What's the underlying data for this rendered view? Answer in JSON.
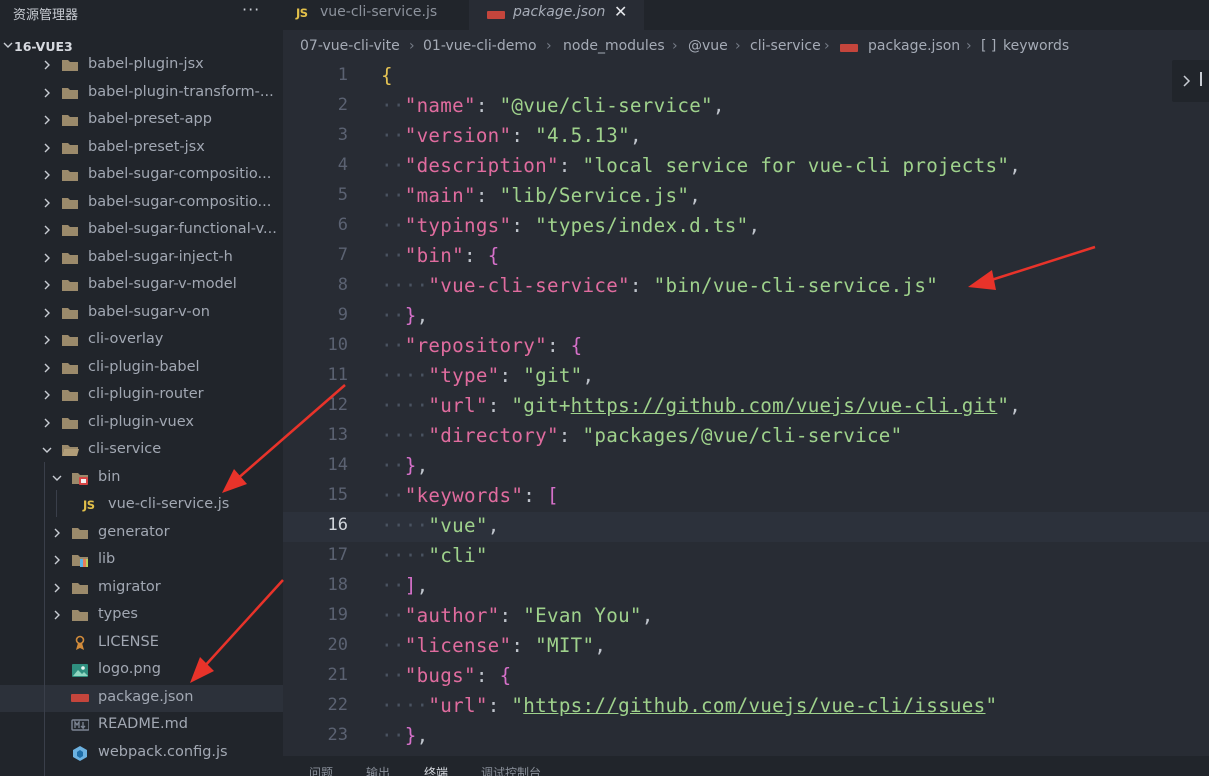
{
  "sidebar": {
    "title": "资源管理器",
    "more": "···",
    "project": "16-VUE3",
    "tree": [
      {
        "label": "babel-plugin-jsx",
        "type": "folder",
        "depth": 0
      },
      {
        "label": "babel-plugin-transform-...",
        "type": "folder",
        "depth": 0
      },
      {
        "label": "babel-preset-app",
        "type": "folder",
        "depth": 0
      },
      {
        "label": "babel-preset-jsx",
        "type": "folder",
        "depth": 0
      },
      {
        "label": "babel-sugar-compositio...",
        "type": "folder",
        "depth": 0
      },
      {
        "label": "babel-sugar-compositio...",
        "type": "folder",
        "depth": 0
      },
      {
        "label": "babel-sugar-functional-v...",
        "type": "folder",
        "depth": 0
      },
      {
        "label": "babel-sugar-inject-h",
        "type": "folder",
        "depth": 0
      },
      {
        "label": "babel-sugar-v-model",
        "type": "folder",
        "depth": 0
      },
      {
        "label": "babel-sugar-v-on",
        "type": "folder",
        "depth": 0
      },
      {
        "label": "cli-overlay",
        "type": "folder",
        "depth": 0
      },
      {
        "label": "cli-plugin-babel",
        "type": "folder",
        "depth": 0
      },
      {
        "label": "cli-plugin-router",
        "type": "folder",
        "depth": 0
      },
      {
        "label": "cli-plugin-vuex",
        "type": "folder",
        "depth": 0
      },
      {
        "label": "cli-service",
        "type": "folder-open",
        "depth": 0
      },
      {
        "label": "bin",
        "type": "folder-bin-open",
        "depth": 1
      },
      {
        "label": "vue-cli-service.js",
        "type": "js",
        "depth": 2
      },
      {
        "label": "generator",
        "type": "folder",
        "depth": 1
      },
      {
        "label": "lib",
        "type": "folder-lib",
        "depth": 1
      },
      {
        "label": "migrator",
        "type": "folder",
        "depth": 1
      },
      {
        "label": "types",
        "type": "folder",
        "depth": 1
      },
      {
        "label": "LICENSE",
        "type": "license",
        "depth": 1
      },
      {
        "label": "logo.png",
        "type": "image",
        "depth": 1
      },
      {
        "label": "package.json",
        "type": "npm",
        "depth": 1,
        "selected": true
      },
      {
        "label": "README.md",
        "type": "markdown",
        "depth": 1
      },
      {
        "label": "webpack.config.js",
        "type": "webpack",
        "depth": 1
      }
    ]
  },
  "tabs": [
    {
      "badge": "JS",
      "label": "vue-cli-service.js"
    },
    {
      "label": "package.json",
      "close": "✕"
    }
  ],
  "breadcrumb": [
    "07-vue-cli-vite",
    "01-vue-cli-demo",
    "node_modules",
    "@vue",
    "cli-service",
    "package.json",
    "[ ]",
    "keywords"
  ],
  "code": {
    "current_line": 16,
    "lines": [
      [
        [
          "b1",
          "{"
        ]
      ],
      [
        [
          "ws",
          "··"
        ],
        [
          "k",
          "\"name\""
        ],
        [
          "p",
          ": "
        ],
        [
          "s",
          "\"@vue/cli-service\""
        ],
        [
          "p",
          ","
        ]
      ],
      [
        [
          "ws",
          "··"
        ],
        [
          "k",
          "\"version\""
        ],
        [
          "p",
          ": "
        ],
        [
          "s",
          "\"4.5.13\""
        ],
        [
          "p",
          ","
        ]
      ],
      [
        [
          "ws",
          "··"
        ],
        [
          "k",
          "\"description\""
        ],
        [
          "p",
          ": "
        ],
        [
          "s",
          "\"local service for vue-cli projects\""
        ],
        [
          "p",
          ","
        ]
      ],
      [
        [
          "ws",
          "··"
        ],
        [
          "k",
          "\"main\""
        ],
        [
          "p",
          ": "
        ],
        [
          "s",
          "\"lib/Service.js\""
        ],
        [
          "p",
          ","
        ]
      ],
      [
        [
          "ws",
          "··"
        ],
        [
          "k",
          "\"typings\""
        ],
        [
          "p",
          ": "
        ],
        [
          "s",
          "\"types/index.d.ts\""
        ],
        [
          "p",
          ","
        ]
      ],
      [
        [
          "ws",
          "··"
        ],
        [
          "k",
          "\"bin\""
        ],
        [
          "p",
          ": "
        ],
        [
          "b2",
          "{"
        ]
      ],
      [
        [
          "ws",
          "····"
        ],
        [
          "k",
          "\"vue-cli-service\""
        ],
        [
          "p",
          ": "
        ],
        [
          "s",
          "\"bin/vue-cli-service.js\""
        ]
      ],
      [
        [
          "ws",
          "··"
        ],
        [
          "b2",
          "}"
        ],
        [
          "p",
          ","
        ]
      ],
      [
        [
          "ws",
          "··"
        ],
        [
          "k",
          "\"repository\""
        ],
        [
          "p",
          ": "
        ],
        [
          "b2",
          "{"
        ]
      ],
      [
        [
          "ws",
          "····"
        ],
        [
          "k",
          "\"type\""
        ],
        [
          "p",
          ": "
        ],
        [
          "s",
          "\"git\""
        ],
        [
          "p",
          ","
        ]
      ],
      [
        [
          "ws",
          "····"
        ],
        [
          "k",
          "\"url\""
        ],
        [
          "p",
          ": "
        ],
        [
          "s",
          "\"git+"
        ],
        [
          "su",
          "https://github.com/vuejs/vue-cli.git"
        ],
        [
          "s",
          "\""
        ],
        [
          "p",
          ","
        ]
      ],
      [
        [
          "ws",
          "····"
        ],
        [
          "k",
          "\"directory\""
        ],
        [
          "p",
          ": "
        ],
        [
          "s",
          "\"packages/@vue/cli-service\""
        ]
      ],
      [
        [
          "ws",
          "··"
        ],
        [
          "b2",
          "}"
        ],
        [
          "p",
          ","
        ]
      ],
      [
        [
          "ws",
          "··"
        ],
        [
          "k",
          "\"keywords\""
        ],
        [
          "p",
          ": "
        ],
        [
          "b2",
          "["
        ]
      ],
      [
        [
          "ws",
          "····"
        ],
        [
          "s",
          "\"vue\""
        ],
        [
          "p",
          ","
        ]
      ],
      [
        [
          "ws",
          "····"
        ],
        [
          "s",
          "\"cli\""
        ]
      ],
      [
        [
          "ws",
          "··"
        ],
        [
          "b2",
          "]"
        ],
        [
          "p",
          ","
        ]
      ],
      [
        [
          "ws",
          "··"
        ],
        [
          "k",
          "\"author\""
        ],
        [
          "p",
          ": "
        ],
        [
          "s",
          "\"Evan You\""
        ],
        [
          "p",
          ","
        ]
      ],
      [
        [
          "ws",
          "··"
        ],
        [
          "k",
          "\"license\""
        ],
        [
          "p",
          ": "
        ],
        [
          "s",
          "\"MIT\""
        ],
        [
          "p",
          ","
        ]
      ],
      [
        [
          "ws",
          "··"
        ],
        [
          "k",
          "\"bugs\""
        ],
        [
          "p",
          ": "
        ],
        [
          "b2",
          "{"
        ]
      ],
      [
        [
          "ws",
          "····"
        ],
        [
          "k",
          "\"url\""
        ],
        [
          "p",
          ": "
        ],
        [
          "s",
          "\""
        ],
        [
          "su",
          "https://github.com/vuejs/vue-cli/issues"
        ],
        [
          "s",
          "\""
        ]
      ],
      [
        [
          "ws",
          "··"
        ],
        [
          "b2",
          "}"
        ],
        [
          "p",
          ","
        ]
      ]
    ]
  },
  "panel_tabs": [
    "问题",
    "输出",
    "终端",
    "调试控制台"
  ],
  "colors": {
    "string": "#9fd28c",
    "key": "#e06c9f",
    "bracket_outer": "#e5c454",
    "bracket_inner": "#d570c9",
    "annotation_arrow": "#e8332a"
  }
}
